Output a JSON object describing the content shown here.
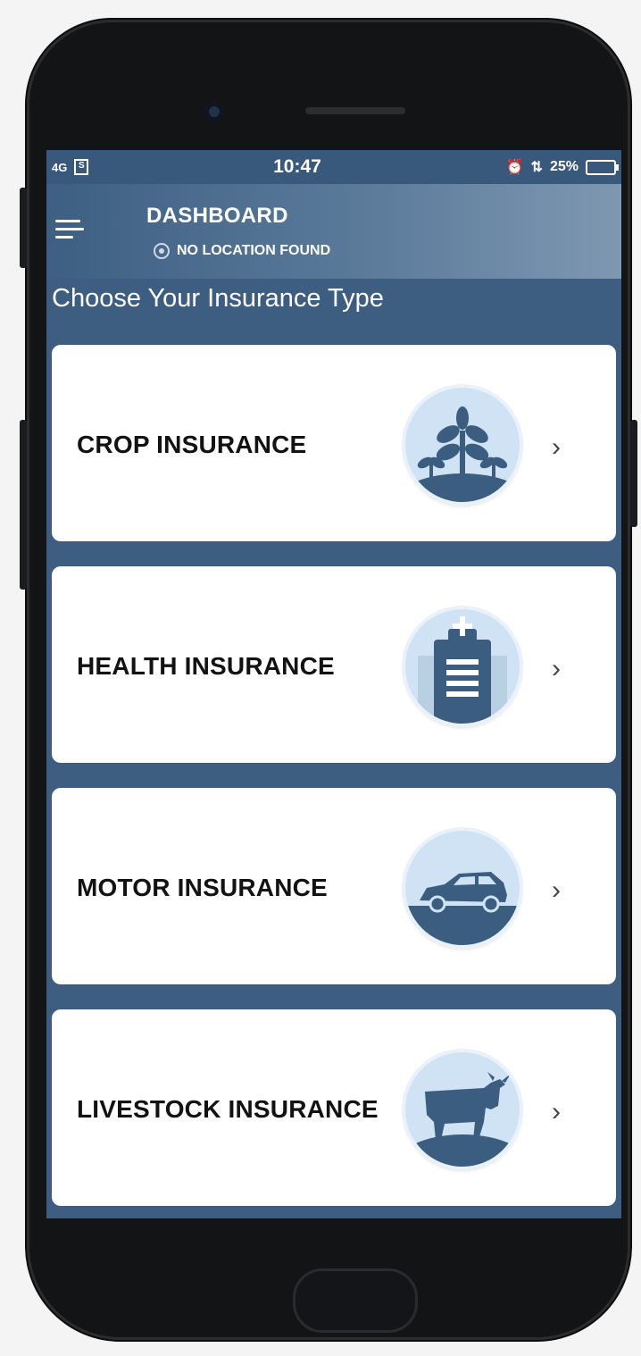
{
  "status_bar": {
    "signal": "4G",
    "time": "10:47",
    "battery": "25%"
  },
  "app_bar": {
    "title": "DASHBOARD",
    "location": "NO LOCATION FOUND"
  },
  "section_title": "Choose Your Insurance Type",
  "cards": [
    {
      "label": "CROP INSURANCE",
      "icon": "plant-icon"
    },
    {
      "label": "HEALTH INSURANCE",
      "icon": "medical-kit-icon"
    },
    {
      "label": "MOTOR INSURANCE",
      "icon": "car-icon"
    },
    {
      "label": "LIVESTOCK INSURANCE",
      "icon": "cow-icon"
    }
  ],
  "colors": {
    "primary": "#3d5e80",
    "icon_bg": "#cfe3f4",
    "icon_fg": "#3b5d80"
  }
}
